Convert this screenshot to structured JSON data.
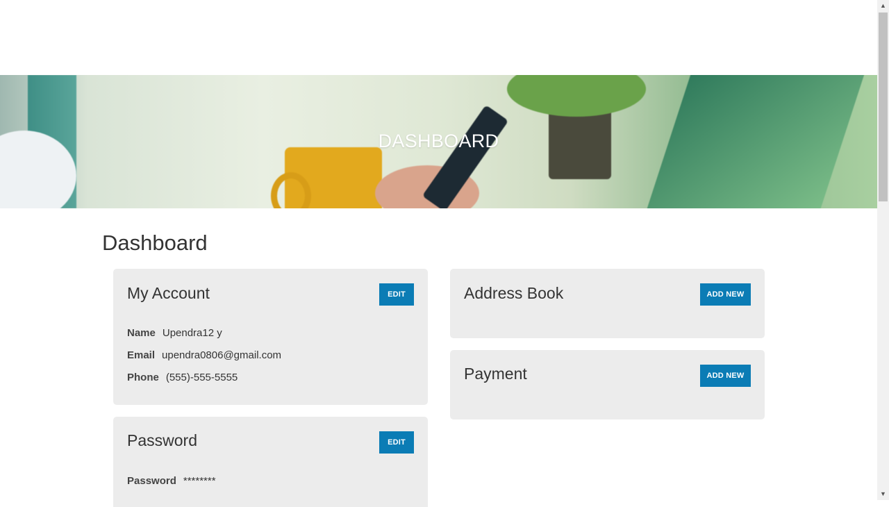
{
  "hero": {
    "title": "DASHBOARD"
  },
  "page": {
    "title": "Dashboard"
  },
  "my_account": {
    "title": "My Account",
    "edit_label": "EDIT",
    "name_label": "Name",
    "name_value": "Upendra12 y",
    "email_label": "Email",
    "email_value": "upendra0806@gmail.com",
    "phone_label": "Phone",
    "phone_value": "(555)-555-5555"
  },
  "password": {
    "title": "Password",
    "edit_label": "EDIT",
    "field_label": "Password",
    "field_value": "********"
  },
  "address_book": {
    "title": "Address Book",
    "add_label": "ADD NEW"
  },
  "payment": {
    "title": "Payment",
    "add_label": "ADD NEW"
  },
  "colors": {
    "accent": "#0b7cb5",
    "card_bg": "#ececec"
  },
  "icons": {
    "scroll_up": "triangle-up",
    "scroll_down": "triangle-down"
  }
}
